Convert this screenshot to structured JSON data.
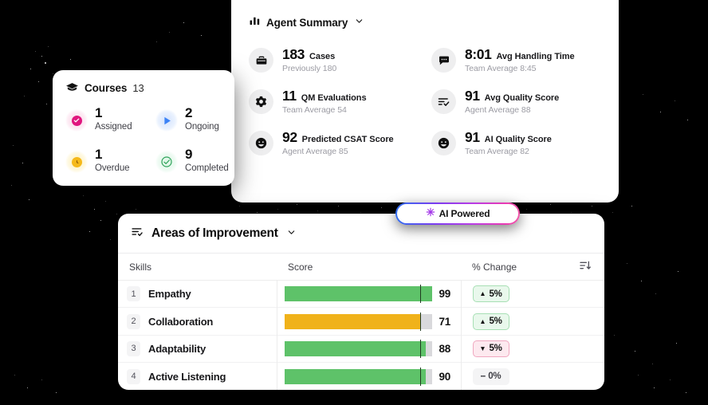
{
  "courses": {
    "icon": "graduation-cap-icon",
    "title": "Courses",
    "count": "13",
    "stats": [
      {
        "icon": "check-circle-filled-icon",
        "value": "1",
        "label": "Assigned",
        "color": "#e0157e"
      },
      {
        "icon": "play-triangle-icon",
        "value": "2",
        "label": "Ongoing",
        "color": "#3b82f6"
      },
      {
        "icon": "clock-icon",
        "value": "1",
        "label": "Overdue",
        "color": "#f5b91b"
      },
      {
        "icon": "check-circle-outline-icon",
        "value": "9",
        "label": "Completed",
        "color": "#22c55e"
      }
    ]
  },
  "agent_summary": {
    "icon": "bar-chart-icon",
    "title": "Agent Summary",
    "chevron": "chevron-down-icon",
    "metrics": [
      {
        "icon": "briefcase-icon",
        "value": "183",
        "name": "Cases",
        "sub": "Previously 180"
      },
      {
        "icon": "chat-bubble-icon",
        "value": "8:01",
        "name": "Avg Handling Time",
        "sub": "Team Average 8:45"
      },
      {
        "icon": "gear-icon",
        "value": "11",
        "name": "QM Evaluations",
        "sub": "Team Average 54"
      },
      {
        "icon": "list-check-icon",
        "value": "91",
        "name": "Avg Quality Score",
        "sub": "Agent Average 88"
      },
      {
        "icon": "smiley-face-icon",
        "value": "92",
        "name": "Predicted CSAT Score",
        "sub": "Agent Average 85"
      },
      {
        "icon": "smiley-face-icon",
        "value": "91",
        "name": "AI Quality Score",
        "sub": "Team Average 82"
      }
    ]
  },
  "ai_badge": {
    "icon": "sparkle-icon",
    "label": "AI Powered",
    "gradient": "#2f6ff0,#7a3cf0,#b93ce6,#e93ab3"
  },
  "improvement": {
    "icon": "sort-lines-icon",
    "title": "Areas of Improvement",
    "chevron": "chevron-down-icon",
    "sort_icon": "sort-descending-icon",
    "columns": [
      "Skills",
      "Score",
      "% Change"
    ],
    "rows": [
      {
        "rank": "1",
        "skill": "Empathy",
        "score": "99",
        "fill_pct": 100,
        "bar_color": "#5ec269",
        "target_pct": 92,
        "change": "5%",
        "direction": "up",
        "arrow": "▲"
      },
      {
        "rank": "2",
        "skill": "Collaboration",
        "score": "71",
        "fill_pct": 92,
        "bar_color": "#f0b21a",
        "target_pct": 92,
        "change": "5%",
        "direction": "up",
        "arrow": "▲"
      },
      {
        "rank": "3",
        "skill": "Adaptability",
        "score": "88",
        "fill_pct": 96,
        "bar_color": "#5ec269",
        "target_pct": 92,
        "change": "5%",
        "direction": "down",
        "arrow": "▼"
      },
      {
        "rank": "4",
        "skill": "Active Listening",
        "score": "90",
        "fill_pct": 96,
        "bar_color": "#5ec269",
        "target_pct": 92,
        "change": "0%",
        "direction": "flat",
        "arrow": "--"
      }
    ]
  },
  "chart_data": {
    "type": "bar",
    "title": "Areas of Improvement",
    "categories": [
      "Empathy",
      "Collaboration",
      "Adaptability",
      "Active Listening"
    ],
    "values": [
      99,
      71,
      88,
      90
    ],
    "xlabel": "Score",
    "ylabel": "Skills",
    "ylim": [
      0,
      100
    ],
    "grid": false,
    "series": [
      {
        "name": "Score",
        "values": [
          99,
          71,
          88,
          90
        ]
      },
      {
        "name": "% Change",
        "values": [
          5,
          5,
          -5,
          0
        ]
      }
    ],
    "annotations": [
      "target marker at 92 on each bar"
    ]
  }
}
